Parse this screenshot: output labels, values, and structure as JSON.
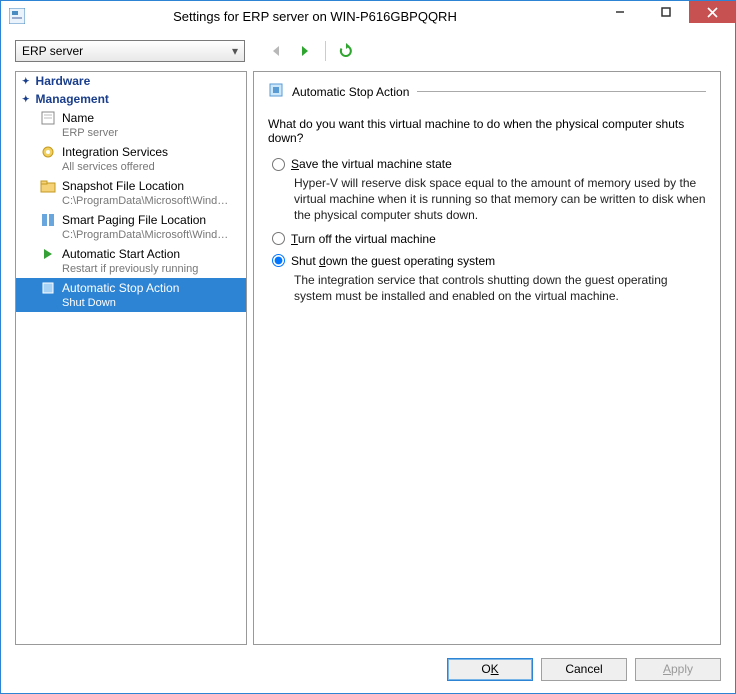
{
  "window": {
    "title": "Settings for ERP server on WIN-P616GBPQQRH"
  },
  "toolbar": {
    "combo_value": "ERP server"
  },
  "sidebar": {
    "cat_hardware": "Hardware",
    "cat_management": "Management",
    "items": [
      {
        "label": "Name",
        "sub": "ERP server"
      },
      {
        "label": "Integration Services",
        "sub": "All services offered"
      },
      {
        "label": "Snapshot File Location",
        "sub": "C:\\ProgramData\\Microsoft\\Windo..."
      },
      {
        "label": "Smart Paging File Location",
        "sub": "C:\\ProgramData\\Microsoft\\Windo..."
      },
      {
        "label": "Automatic Start Action",
        "sub": "Restart if previously running"
      },
      {
        "label": "Automatic Stop Action",
        "sub": "Shut Down"
      }
    ]
  },
  "content": {
    "section_title": "Automatic Stop Action",
    "question": "What do you want this virtual machine to do when the physical computer shuts down?",
    "opt1": {
      "label_pre": "S",
      "label_post": "ave the virtual machine state",
      "desc": "Hyper-V will reserve disk space equal to the amount of memory used by the virtual machine when it is running so that memory can be written to disk when the physical computer shuts down."
    },
    "opt2": {
      "label_pre": "T",
      "label_post": "urn off the virtual machine"
    },
    "opt3": {
      "label_pre": "Shut ",
      "label_ul": "d",
      "label_post": "own the guest operating system",
      "desc": "The integration service that controls shutting down the guest operating system must be installed and enabled on the virtual machine."
    }
  },
  "footer": {
    "ok_pre": "O",
    "ok_ul": "K",
    "cancel": "Cancel",
    "apply_pre": "A",
    "apply_post": "pply"
  }
}
